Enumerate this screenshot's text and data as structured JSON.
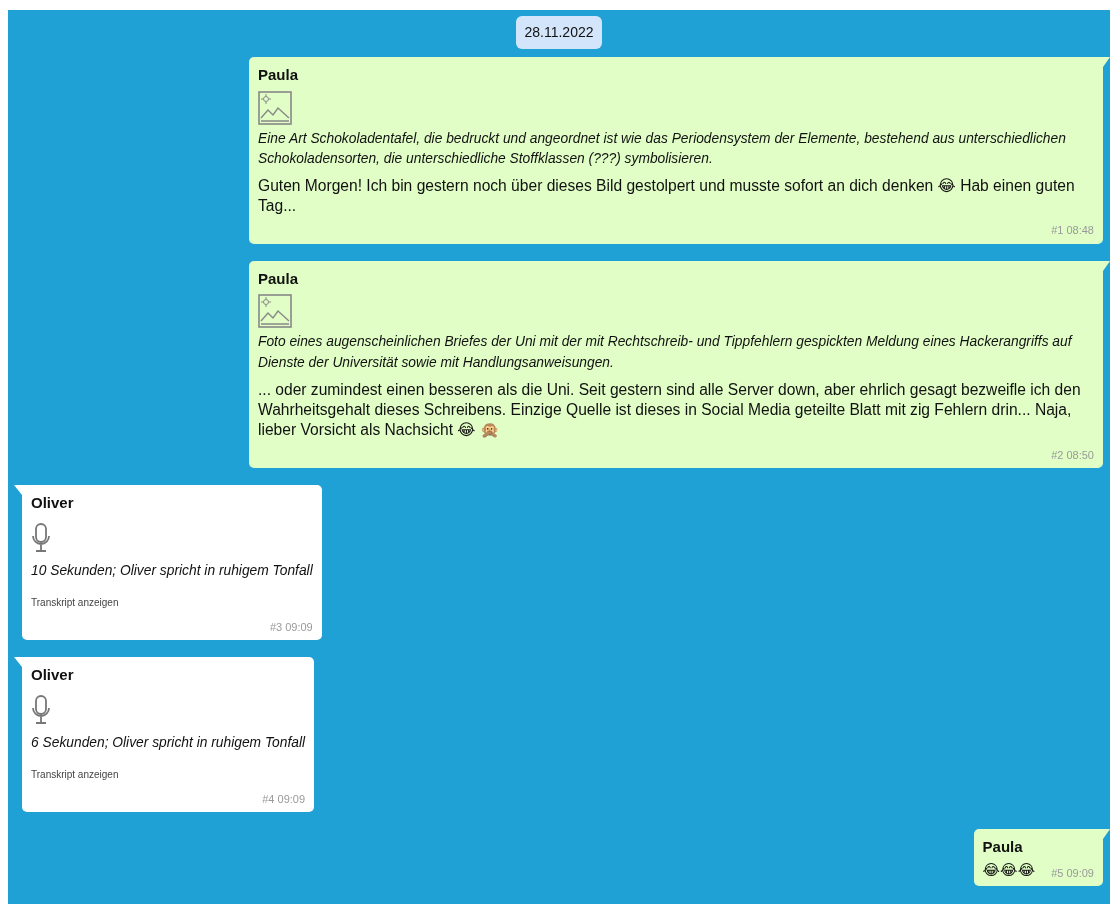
{
  "date": "28.11.2022",
  "messages": [
    {
      "sender": "Paula",
      "outgoing": true,
      "kind": "image",
      "caption": "Eine Art Schokoladentafel, die bedruckt und angeordnet ist wie das Periodensystem der Elemente, bestehend aus unterschiedlichen Schokoladensorten, die unterschiedliche Stoffklassen (???) symbolisieren.",
      "text": "Guten Morgen! Ich bin gestern noch über dieses Bild gestolpert und musste sofort an dich denken 😂 Hab einen guten Tag...",
      "meta": "#1 08:48"
    },
    {
      "sender": "Paula",
      "outgoing": true,
      "kind": "image",
      "caption": "Foto eines augenscheinlichen Briefes der Uni mit der mit Rechtschreib- und Tippfehlern gespickten Meldung eines Hackerangriffs auf Dienste der Universität sowie mit Handlungsanweisungen.",
      "text": "... oder zumindest einen besseren als die Uni. Seit gestern sind alle Server down, aber ehrlich gesagt bezweifle ich den Wahrheitsgehalt dieses Schreibens. Einzige Quelle ist dieses in Social Media geteilte Blatt mit zig Fehlern drin... Naja, lieber Vorsicht als Nachsicht 😂 🙊",
      "meta": "#2 08:50"
    },
    {
      "sender": "Oliver",
      "outgoing": false,
      "kind": "voice",
      "caption": "10 Sekunden; Oliver spricht in ruhigem Tonfall",
      "link": "Transkript anzeigen",
      "meta": "#3 09:09"
    },
    {
      "sender": "Oliver",
      "outgoing": false,
      "kind": "voice",
      "caption": "6 Sekunden; Oliver spricht in ruhigem Tonfall",
      "link": "Transkript anzeigen",
      "meta": "#4 09:09"
    },
    {
      "sender": "Paula",
      "outgoing": true,
      "kind": "text",
      "text": "😂😂😂",
      "meta": "#5 09:09"
    }
  ]
}
